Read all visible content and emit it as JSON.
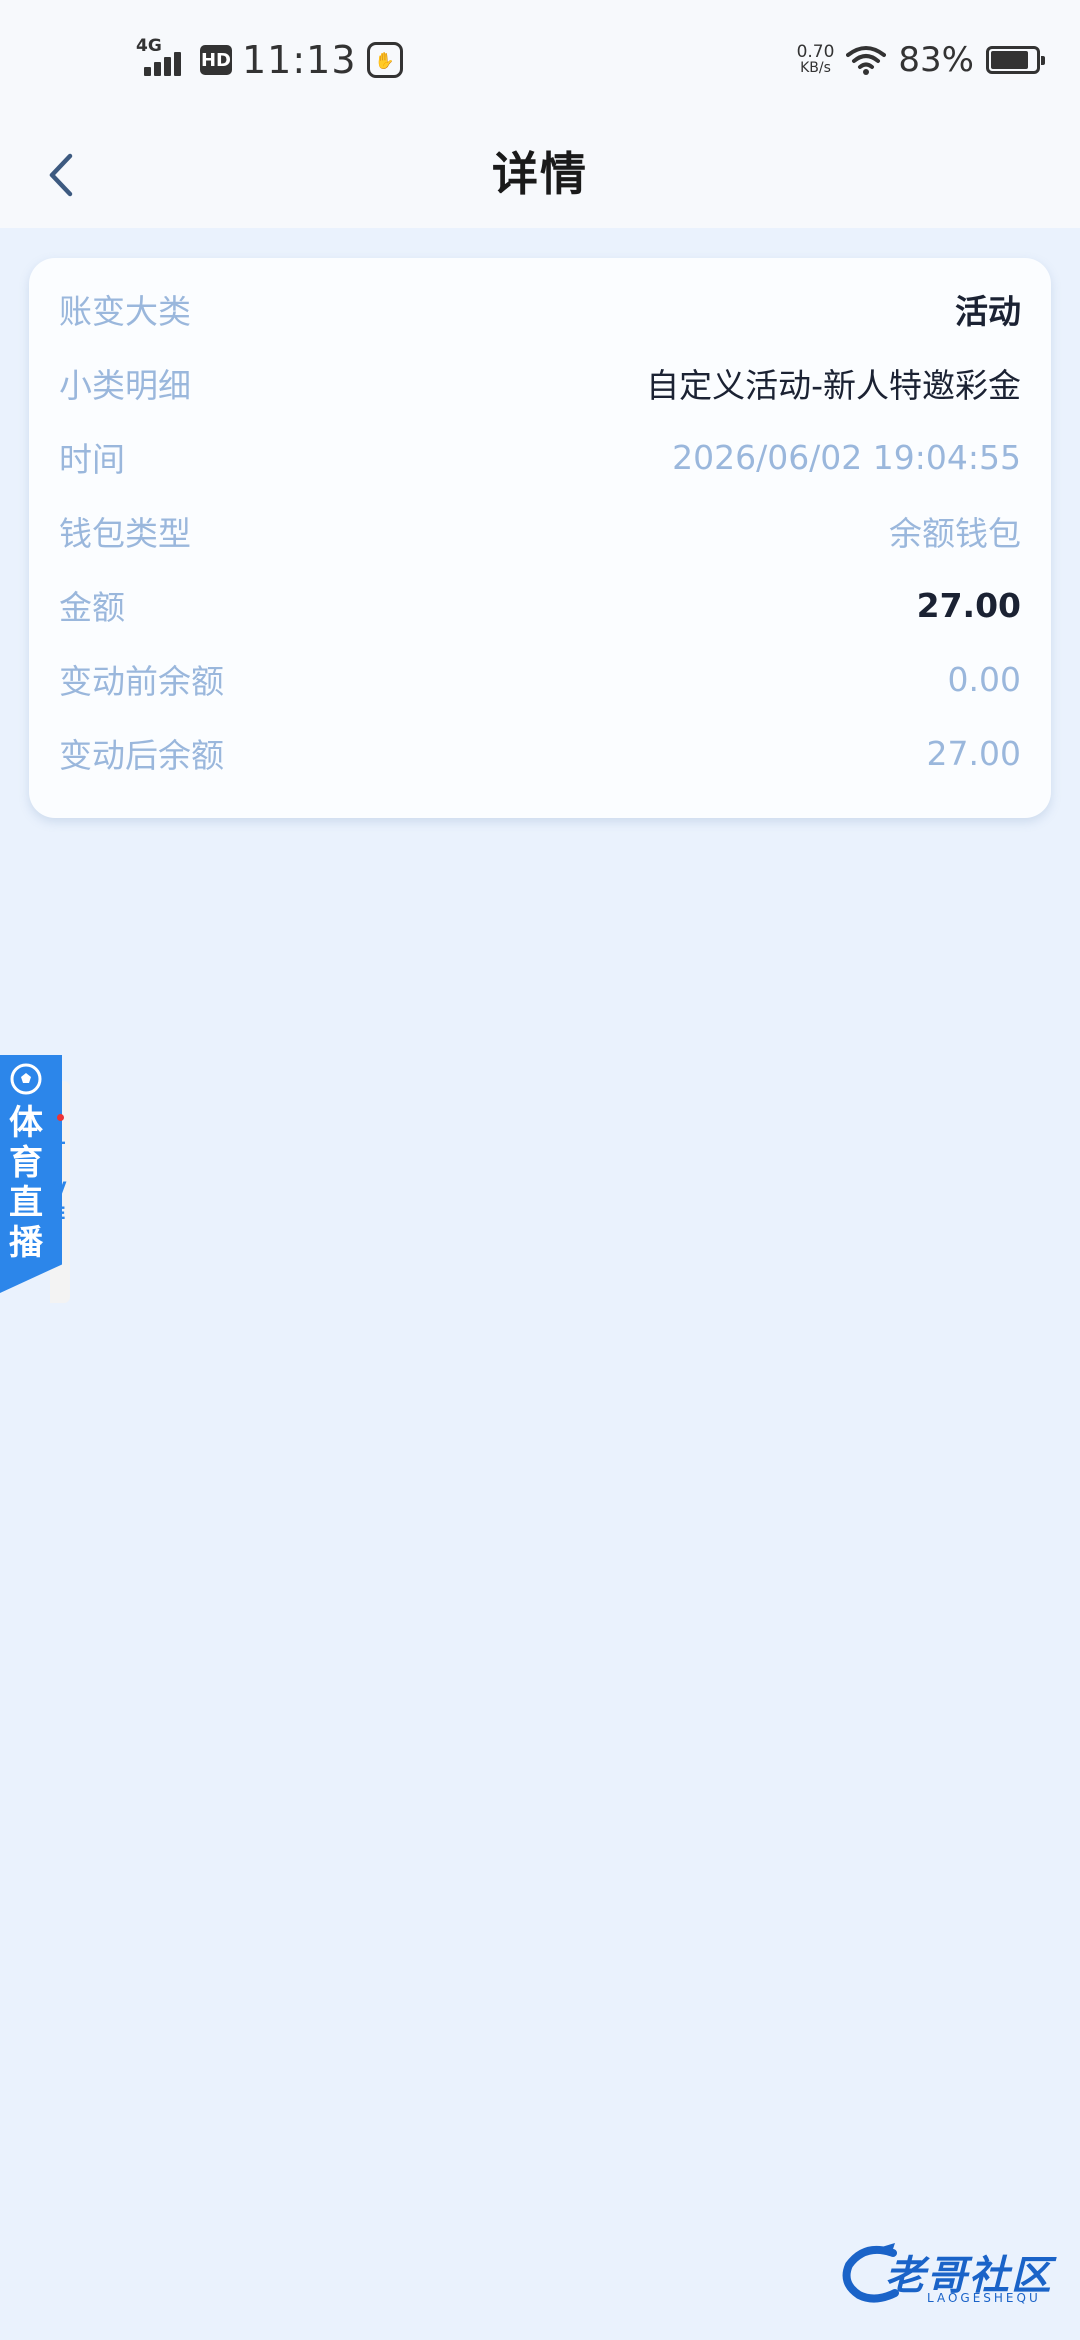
{
  "status_bar": {
    "network": "4G",
    "hd": "HD",
    "time": "11:13",
    "speed_value": "0.70",
    "speed_unit": "KB/s",
    "battery_percent": "83%",
    "battery_level": 0.83
  },
  "header": {
    "title": "详情",
    "back_icon": "chevron-left-icon"
  },
  "details": [
    {
      "label": "账变大类",
      "value": "活动"
    },
    {
      "label": "小类明细",
      "value": "自定义活动-新人特邀彩金"
    },
    {
      "label": "时间",
      "value": "2026/06/02 19:04:55"
    },
    {
      "label": "钱包类型",
      "value": "余额钱包"
    },
    {
      "label": "金额",
      "value": "27.00"
    },
    {
      "label": "变动前余额",
      "value": "0.00"
    },
    {
      "label": "变动后余额",
      "value": "27.00"
    }
  ],
  "live_tab": {
    "chars": [
      "体",
      "育",
      "直",
      "播"
    ],
    "live_letters": [
      "L",
      "I",
      "V",
      "E"
    ],
    "icon": "soccer-ball-icon"
  },
  "watermark": {
    "text": "老哥社区",
    "sub": "LAOGESHEQU"
  },
  "colors": {
    "background": "#eaf2fd",
    "label": "#9ab7dc",
    "dark_text": "#1b2233",
    "accent_blue": "#2c86ea"
  }
}
